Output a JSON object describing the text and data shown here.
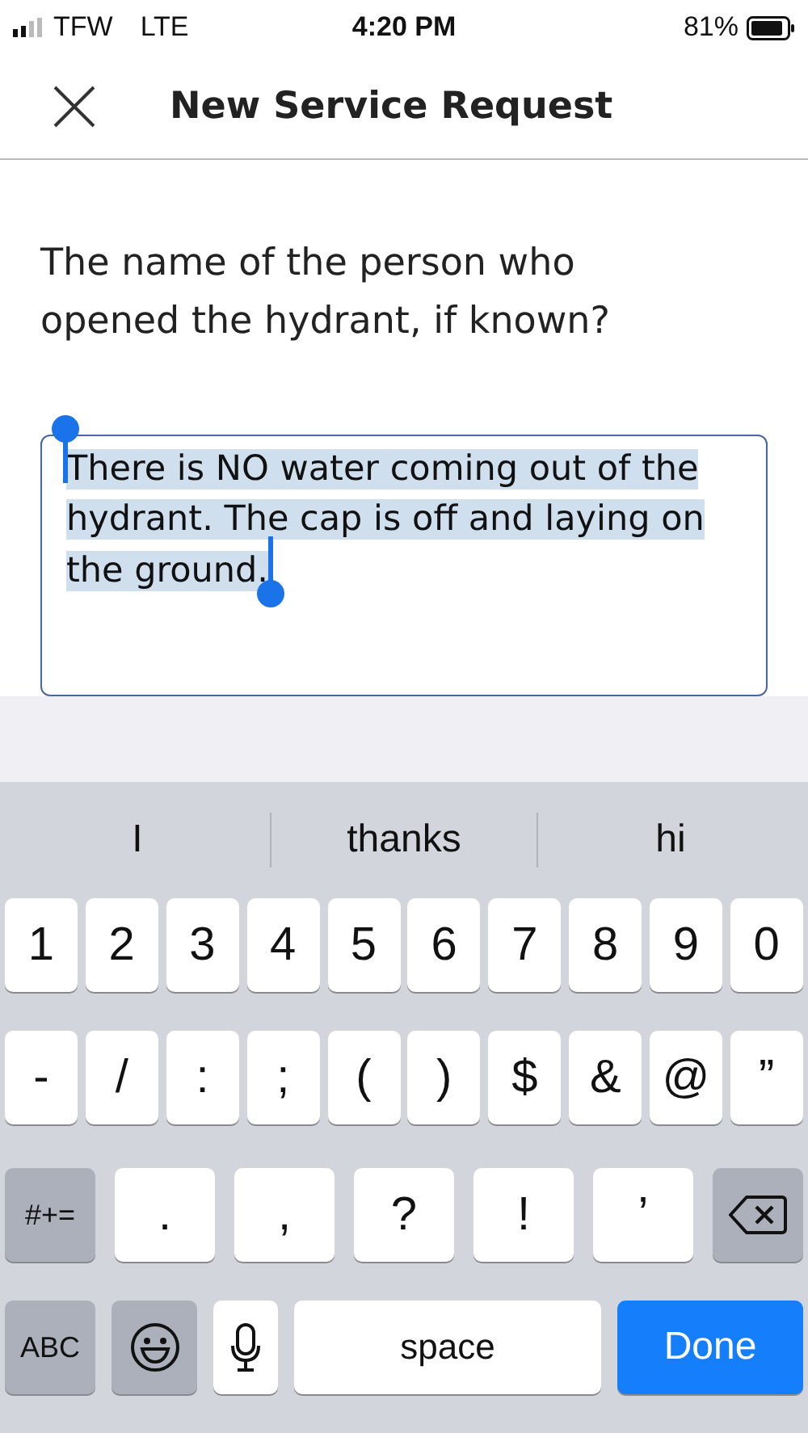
{
  "status_bar": {
    "carrier": "TFW",
    "network": "LTE",
    "time": "4:20 PM",
    "battery": "81%"
  },
  "header": {
    "title": "New Service Request"
  },
  "question": "The name of the person who opened the hydrant, if known?",
  "answer": {
    "value": "There is NO water coming out of the hydrant. The cap is off and laying on the ground.",
    "selected": true
  },
  "keyboard": {
    "suggestions": [
      "I",
      "thanks",
      "hi"
    ],
    "digit_row": [
      {
        "kind": "char",
        "label": "1"
      },
      {
        "kind": "char",
        "label": "2"
      },
      {
        "kind": "char",
        "label": "3"
      },
      {
        "kind": "char",
        "label": "4"
      },
      {
        "kind": "char",
        "label": "5"
      },
      {
        "kind": "char",
        "label": "6"
      },
      {
        "kind": "char",
        "label": "7"
      },
      {
        "kind": "char",
        "label": "8"
      },
      {
        "kind": "char",
        "label": "9"
      },
      {
        "kind": "char",
        "label": "0"
      }
    ],
    "symbol_row": [
      {
        "kind": "char",
        "label": "-"
      },
      {
        "kind": "char",
        "label": "/"
      },
      {
        "kind": "char",
        "label": ":"
      },
      {
        "kind": "char",
        "label": ";"
      },
      {
        "kind": "char",
        "label": "("
      },
      {
        "kind": "char",
        "label": ")"
      },
      {
        "kind": "char",
        "label": "$"
      },
      {
        "kind": "char",
        "label": "&"
      },
      {
        "kind": "char",
        "label": "@"
      },
      {
        "kind": "char",
        "label": "”"
      }
    ],
    "punctuation_row": [
      {
        "kind": "mode",
        "label": "#+="
      },
      {
        "kind": "wide",
        "label": "."
      },
      {
        "kind": "wide",
        "label": ","
      },
      {
        "kind": "wide",
        "label": "?"
      },
      {
        "kind": "wide",
        "label": "!"
      },
      {
        "kind": "wide",
        "label": "’"
      },
      {
        "kind": "delete"
      }
    ],
    "bottom_row": [
      {
        "kind": "mode",
        "label": "ABC"
      },
      {
        "kind": "emoji"
      },
      {
        "kind": "mic"
      },
      {
        "kind": "space",
        "label": "space"
      },
      {
        "kind": "done",
        "label": "Done"
      }
    ]
  }
}
